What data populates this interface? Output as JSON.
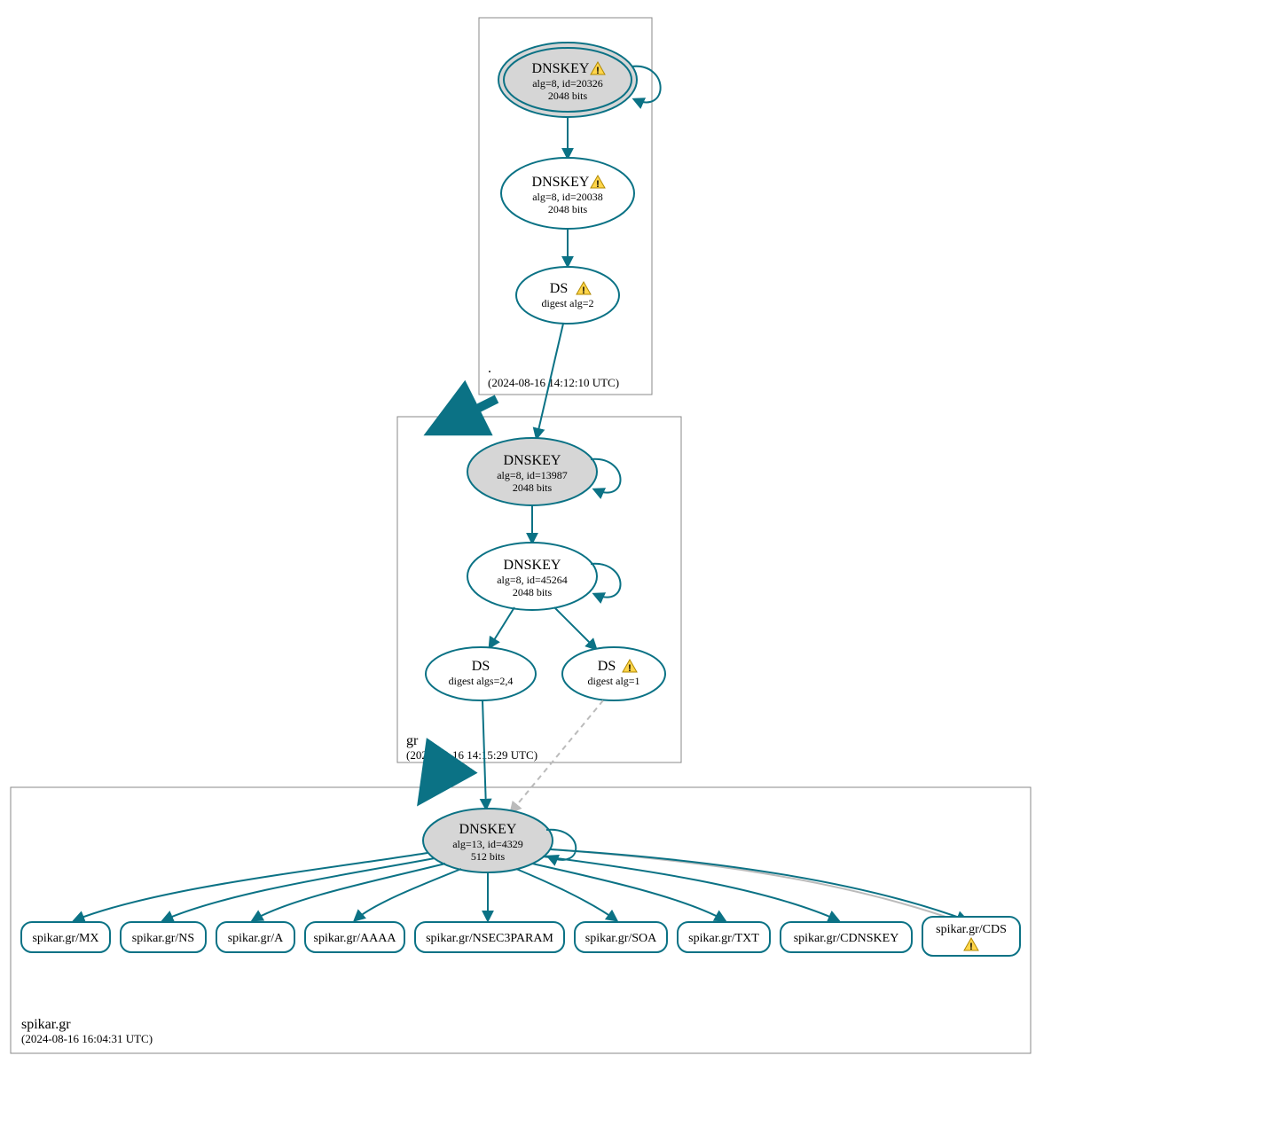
{
  "zones": {
    "root": {
      "label": ".",
      "timestamp": "(2024-08-16 14:12:10 UTC)"
    },
    "gr": {
      "label": "gr",
      "timestamp": "(2024-08-16 14:15:29 UTC)"
    },
    "spikar": {
      "label": "spikar.gr",
      "timestamp": "(2024-08-16 16:04:31 UTC)"
    }
  },
  "nodes": {
    "root_ksk": {
      "title": "DNSKEY",
      "sub1": "alg=8, id=20326",
      "sub2": "2048 bits",
      "warn": true
    },
    "root_zsk": {
      "title": "DNSKEY",
      "sub1": "alg=8, id=20038",
      "sub2": "2048 bits",
      "warn": true
    },
    "root_ds": {
      "title": "DS",
      "sub1": "digest alg=2",
      "warn": true
    },
    "gr_ksk": {
      "title": "DNSKEY",
      "sub1": "alg=8, id=13987",
      "sub2": "2048 bits"
    },
    "gr_zsk": {
      "title": "DNSKEY",
      "sub1": "alg=8, id=45264",
      "sub2": "2048 bits"
    },
    "gr_ds1": {
      "title": "DS",
      "sub1": "digest algs=2,4"
    },
    "gr_ds2": {
      "title": "DS",
      "sub1": "digest alg=1",
      "warn": true
    },
    "sp_ksk": {
      "title": "DNSKEY",
      "sub1": "alg=13, id=4329",
      "sub2": "512 bits"
    }
  },
  "rr": {
    "mx": {
      "label": "spikar.gr/MX"
    },
    "ns": {
      "label": "spikar.gr/NS"
    },
    "a": {
      "label": "spikar.gr/A"
    },
    "aaaa": {
      "label": "spikar.gr/AAAA"
    },
    "n3p": {
      "label": "spikar.gr/NSEC3PARAM"
    },
    "soa": {
      "label": "spikar.gr/SOA"
    },
    "txt": {
      "label": "spikar.gr/TXT"
    },
    "cdk": {
      "label": "spikar.gr/CDNSKEY"
    },
    "cds": {
      "label": "spikar.gr/CDS",
      "warn": true
    }
  }
}
